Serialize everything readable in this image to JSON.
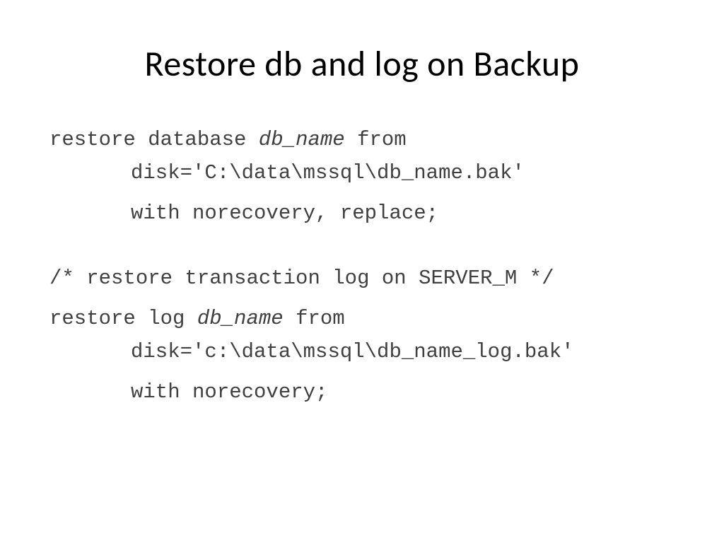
{
  "title": "Restore db and log on Backup",
  "code": {
    "line1_a": "restore database ",
    "line1_b": "db_name",
    "line1_c": " from",
    "line2": "disk='C:\\data\\mssql\\db_name.bak'",
    "line3": "with norecovery, replace;",
    "line4": "/* restore transaction log on SERVER_M */",
    "line5_a": "restore log ",
    "line5_b": "db_name",
    "line5_c": " from",
    "line6": "disk='c:\\data\\mssql\\db_name_log.bak'",
    "line7": "with norecovery;"
  }
}
